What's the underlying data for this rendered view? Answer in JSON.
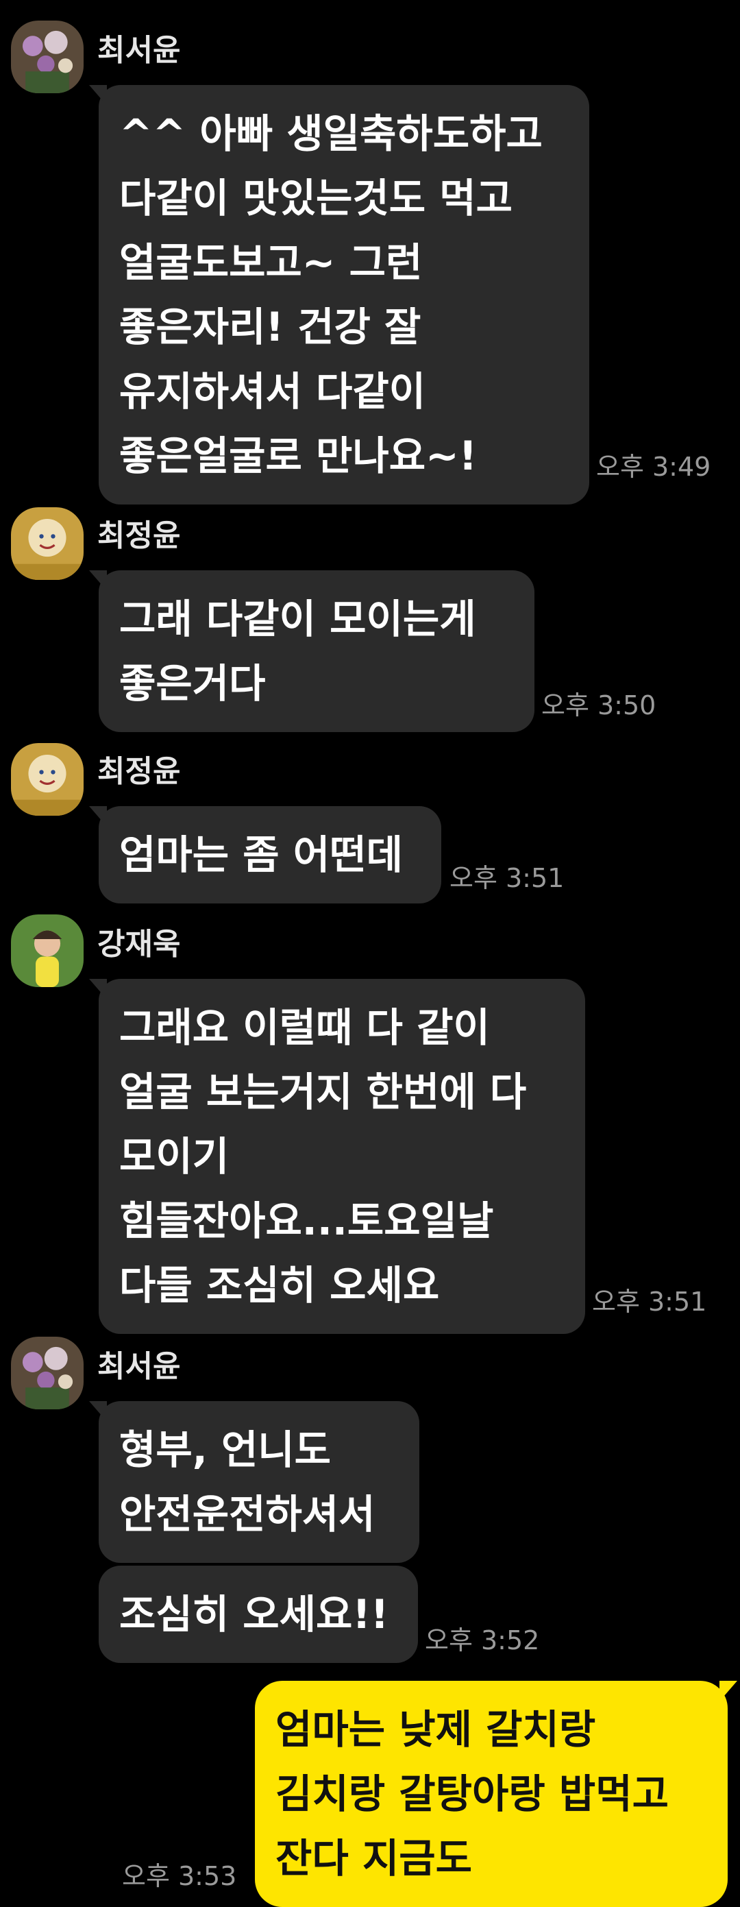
{
  "messages": [
    {
      "sender": "최서윤",
      "text": "^^ 아빠 생일축하도하고\n다같이 맛있는것도 먹고\n얼굴도보고~ 그런\n좋은자리! 건강 잘\n유지하셔서 다같이\n좋은얼굴로 만나요~!",
      "time": "오후 3:49"
    },
    {
      "sender": "최정윤",
      "text": "그래 다같이 모이는게\n좋은거다",
      "time": "오후 3:50"
    },
    {
      "sender": "최정윤",
      "text": "엄마는 좀 어떤데",
      "time": "오후 3:51"
    },
    {
      "sender": "강재욱",
      "text": "그래요 이럴때 다 같이\n얼굴 보는거지 한번에 다\n모이기\n힘들잔아요...토요일날\n다들 조심히 오세요",
      "time": "오후 3:51"
    },
    {
      "sender": "최서윤",
      "text": "형부, 언니도\n안전운전하셔서",
      "time": ""
    },
    {
      "sender": "",
      "text": "조심히 오세요!!",
      "time": "오후 3:52"
    },
    {
      "sender": "me",
      "text": "엄마는 낮제 갈치랑\n김치랑 갈탕아랑 밥먹고\n잔다 지금도",
      "time": "오후 3:53"
    }
  ],
  "colors": {
    "background": "#000000",
    "incoming_bubble": "#2b2b2b",
    "outgoing_bubble": "#fee500",
    "timestamp": "#9a9a9a"
  }
}
